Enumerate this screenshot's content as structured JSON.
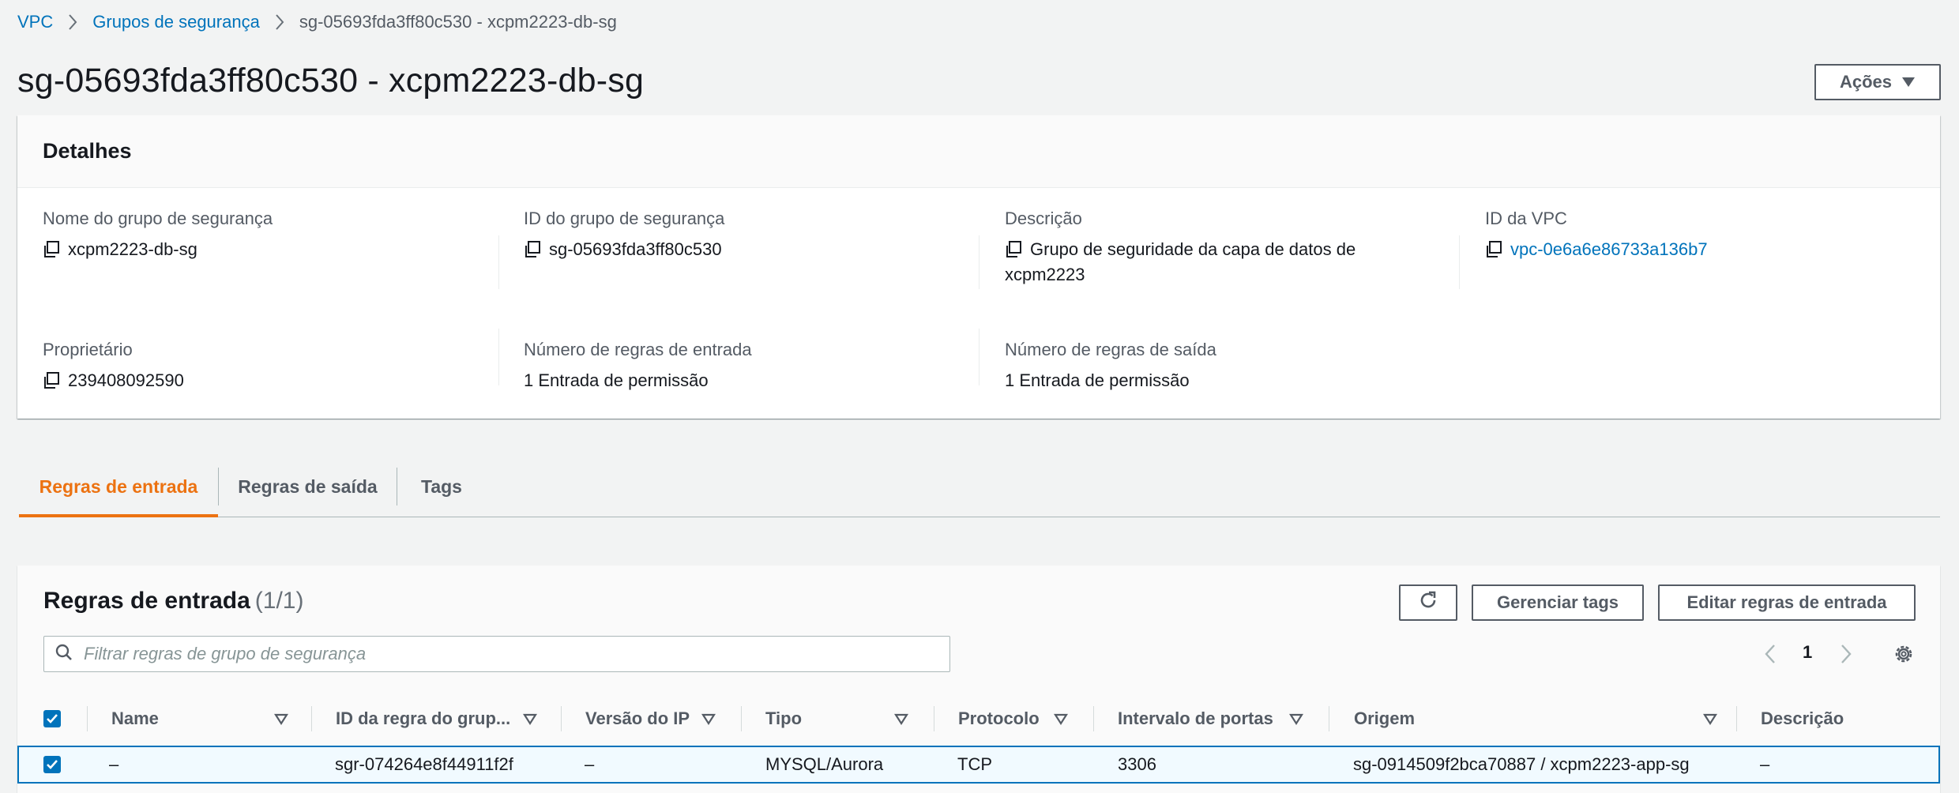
{
  "breadcrumb": {
    "items": [
      "VPC",
      "Grupos de segurança"
    ],
    "current": "sg-05693fda3ff80c530 - xcpm2223-db-sg"
  },
  "page_title": "sg-05693fda3ff80c530 - xcpm2223-db-sg",
  "actions_label": "Ações",
  "details": {
    "title": "Detalhes",
    "group_name_label": "Nome do grupo de segurança",
    "group_name": "xcpm2223-db-sg",
    "group_id_label": "ID do grupo de segurança",
    "group_id": "sg-05693fda3ff80c530",
    "description_label": "Descrição",
    "description_line1": "Grupo de seguridade da capa de datos de",
    "description_line2": "xcpm2223",
    "vpc_id_label": "ID da VPC",
    "vpc_id": "vpc-0e6a6e86733a136b7",
    "owner_label": "Proprietário",
    "owner": "239408092590",
    "inbound_count_label": "Número de regras de entrada",
    "inbound_count": "1 Entrada de permissão",
    "outbound_count_label": "Número de regras de saída",
    "outbound_count": "1 Entrada de permissão"
  },
  "tabs": [
    "Regras de entrada",
    "Regras de saída",
    "Tags"
  ],
  "rules": {
    "title": "Regras de entrada",
    "count": "(1/1)",
    "manage_tags_label": "Gerenciar tags",
    "edit_rules_label": "Editar regras de entrada",
    "filter_placeholder": "Filtrar regras de grupo de segurança",
    "page": "1",
    "columns": [
      "Name",
      "ID da regra do grup...",
      "Versão do IP",
      "Tipo",
      "Protocolo",
      "Intervalo de portas",
      "Origem",
      "Descrição"
    ],
    "rows": [
      [
        "–",
        "sgr-074264e8f44911f2f",
        "–",
        "MYSQL/Aurora",
        "TCP",
        "3306",
        "sg-0914509f2bca70887 / xcpm2223-app-sg",
        "–"
      ]
    ]
  },
  "colors": {
    "link": "#0073bb",
    "accent": "#ec7211",
    "text": "#16191f",
    "muted": "#545b64"
  }
}
